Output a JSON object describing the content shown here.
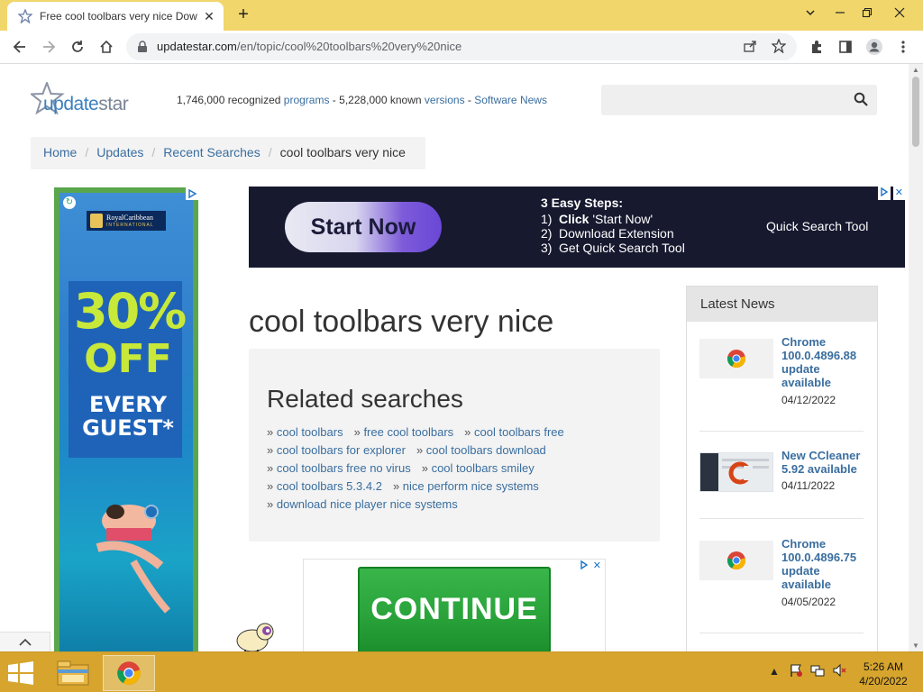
{
  "browser": {
    "tab_title": "Free cool toolbars very nice Dow",
    "new_tab_label": "+",
    "url_host": "updatestar.com",
    "url_path": "/en/topic/cool%20toolbars%20very%20nice"
  },
  "site": {
    "logo_text_a": "update",
    "logo_text_b": "star",
    "stats": {
      "programs_count": "1,746,000 recognized",
      "programs_link": "programs",
      "sep1": " - ",
      "versions_count": "5,228,000 known",
      "versions_link": "versions",
      "sep2": " - ",
      "news_link": "Software News"
    },
    "breadcrumb": {
      "home": "Home",
      "updates": "Updates",
      "recent": "Recent Searches",
      "current": "cool toolbars very nice",
      "sep": "/"
    }
  },
  "ads": {
    "left": {
      "brand": "RoyalCaribbean",
      "brand_sub": "INTERNATIONAL",
      "percent": "30%",
      "off": "OFF",
      "every": "EVERY",
      "guest": "GUEST*"
    },
    "top": {
      "button": "Start Now",
      "steps_title": "3 Easy Steps:",
      "step1_num": "1)",
      "step1_bold": "Click",
      "step1_rest": " 'Start Now'",
      "step2_num": "2)",
      "step2": "Download Extension",
      "step3_num": "3)",
      "step3": "Get Quick Search Tool",
      "product": "Quick Search Tool"
    },
    "continue": {
      "button": "CONTINUE"
    }
  },
  "main": {
    "title": "cool toolbars very nice",
    "related_heading": "Related searches",
    "related_rows": [
      [
        "cool toolbars",
        "free cool toolbars",
        "cool toolbars free"
      ],
      [
        "cool toolbars for explorer",
        "cool toolbars download"
      ],
      [
        "cool toolbars free no virus",
        "cool toolbars smiley"
      ],
      [
        "cool toolbars 5.3.4.2",
        "nice perform nice systems"
      ],
      [
        "download nice player nice systems"
      ]
    ],
    "bullet": "»"
  },
  "news": {
    "heading": "Latest News",
    "items": [
      {
        "title": "Chrome 100.0.4896.88 update available",
        "date": "04/12/2022",
        "icon": "chrome-icon"
      },
      {
        "title": "New CCleaner 5.92 available",
        "date": "04/11/2022",
        "icon": "ccleaner-icon"
      },
      {
        "title": "Chrome 100.0.4896.75 update available",
        "date": "04/05/2022",
        "icon": "chrome-icon"
      }
    ]
  },
  "taskbar": {
    "time": "5:26 AM",
    "date": "4/20/2022"
  },
  "colors": {
    "tabstrip": "#f1d66b",
    "taskbar": "#d7a52d",
    "link": "#3a6e9f"
  }
}
